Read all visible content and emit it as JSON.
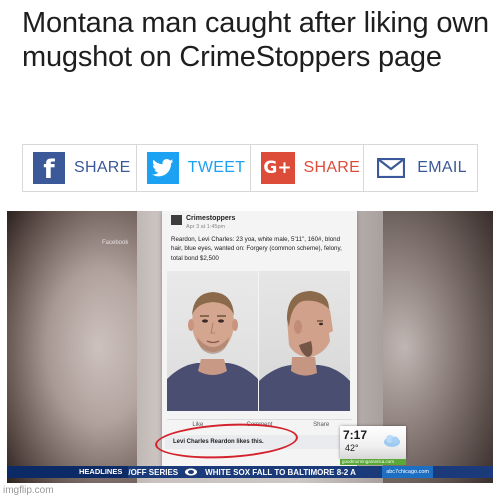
{
  "headline": "Montana man caught after liking own mugshot on CrimeStoppers page",
  "share_buttons": [
    {
      "network": "facebook",
      "icon": "facebook-icon",
      "label": "SHARE",
      "color": "#3b5998"
    },
    {
      "network": "twitter",
      "icon": "twitter-icon",
      "label": "TWEET",
      "color": "#1da1f2"
    },
    {
      "network": "google-plus",
      "icon": "google-plus-icon",
      "label": "SHARE",
      "color": "#dd4b39"
    },
    {
      "network": "email",
      "icon": "email-icon",
      "label": "EMAIL",
      "color": "#3b5998"
    }
  ],
  "video": {
    "watermark": "Facebook",
    "post": {
      "page_name": "Crimestoppers",
      "time": "Apr 3 at 1:45pm",
      "text": "Reardon, Levi Charles: 23 yoa, white male, 5'11\", 160#, blond hair, blue eyes, wanted on: Forgery (common scheme), felony, total bond $2,500",
      "actions": [
        "Like",
        "Comment",
        "Share"
      ],
      "likes_text": "Levi Charles Reardon likes this."
    },
    "clock": {
      "time": "7:17",
      "temp": "42°",
      "site": "goodmorningamerica.com"
    },
    "ticker": {
      "head": "HEADLINES",
      "text": "/OFF SERIES",
      "text2": "WHITE SOX FALL TO BALTIMORE 8-2 A",
      "logo": "abc7chicago.com"
    }
  },
  "watermark": "imgflip.com"
}
